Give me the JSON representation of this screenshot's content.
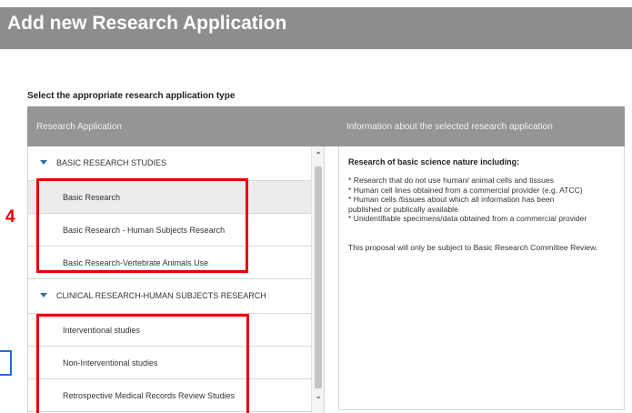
{
  "page": {
    "title": "Add new Research Application"
  },
  "form": {
    "instruction": "Select the appropriate research application type"
  },
  "table": {
    "col_left": "Research Application",
    "col_right": "Information about the selected research application"
  },
  "groups": [
    {
      "label": "BASIC RESEARCH STUDIES",
      "items": [
        {
          "label": "Basic Research"
        },
        {
          "label": "Basic Research - Human Subjects Research"
        },
        {
          "label": "Basic Research-Vertebrate Animals Use"
        }
      ]
    },
    {
      "label": "CLINICAL RESEARCH-HUMAN SUBJECTS RESEARCH",
      "items": [
        {
          "label": "Interventional studies"
        },
        {
          "label": "Non-Interventional studies"
        },
        {
          "label": "Retrospective Medical Records Review Studies"
        }
      ]
    }
  ],
  "info": {
    "heading": "Research of basic science nature including:",
    "lines": [
      "* Research that do not use human/ animal cells and tissues",
      "* Human cell lines obtained from a commercial provider (e.g. ATCC)",
      "* Human cells /tissues about which all information has been",
      "published or publically available",
      "* Unidentifiable specimens/data obtained from a commercial provider"
    ],
    "note": "This proposal will only be subject to Basic Research Committee Review."
  },
  "annotation": {
    "number": "4",
    "color": "#e60000"
  },
  "colors": {
    "header_bg": "#8d8d8d",
    "accent": "#2a6fb0"
  }
}
